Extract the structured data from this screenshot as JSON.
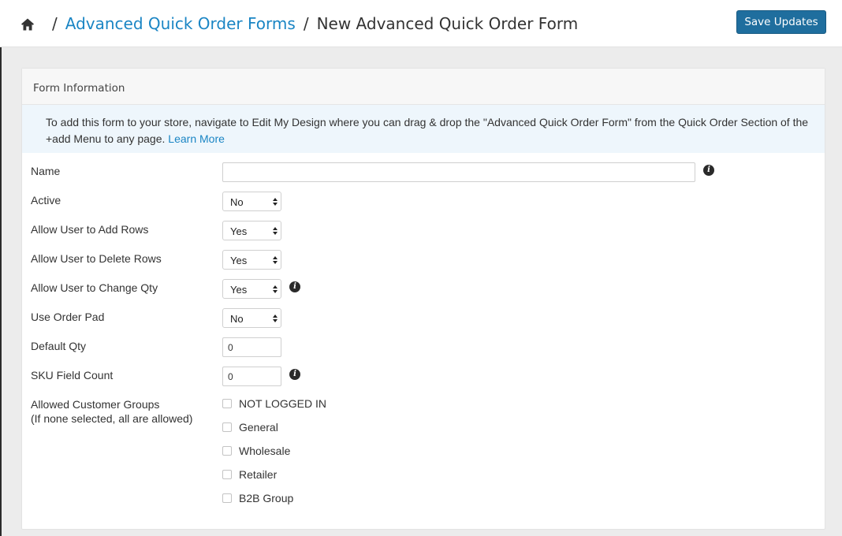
{
  "header": {
    "breadcrumb": {
      "home_icon": "home-icon",
      "separator": "/",
      "parent_link": "Advanced Quick Order Forms",
      "current": "New Advanced Quick Order Form"
    },
    "save_label": "Save Updates"
  },
  "panel": {
    "title": "Form Information",
    "info_text": "To add this form to your store, navigate to Edit My Design where you can drag & drop the \"Advanced Quick Order Form\" from the Quick Order Section of the +add Menu to any page.",
    "info_link": "Learn More"
  },
  "form": {
    "name": {
      "label": "Name",
      "value": ""
    },
    "active": {
      "label": "Active",
      "value": "No"
    },
    "add_rows": {
      "label": "Allow User to Add Rows",
      "value": "Yes"
    },
    "delete_rows": {
      "label": "Allow User to Delete Rows",
      "value": "Yes"
    },
    "change_qty": {
      "label": "Allow User to Change Qty",
      "value": "Yes"
    },
    "order_pad": {
      "label": "Use Order Pad",
      "value": "No"
    },
    "default_qty": {
      "label": "Default Qty",
      "value": "0"
    },
    "sku_count": {
      "label": "SKU Field Count",
      "value": "0"
    },
    "groups": {
      "label": "Allowed Customer Groups",
      "sublabel": "(If none selected, all are allowed)",
      "options": [
        "NOT LOGGED IN",
        "General",
        "Wholesale",
        "Retailer",
        "B2B Group"
      ]
    }
  },
  "colors": {
    "accent": "#1a85c4",
    "button": "#1f6e9e",
    "info_bg": "#eef6fc"
  }
}
